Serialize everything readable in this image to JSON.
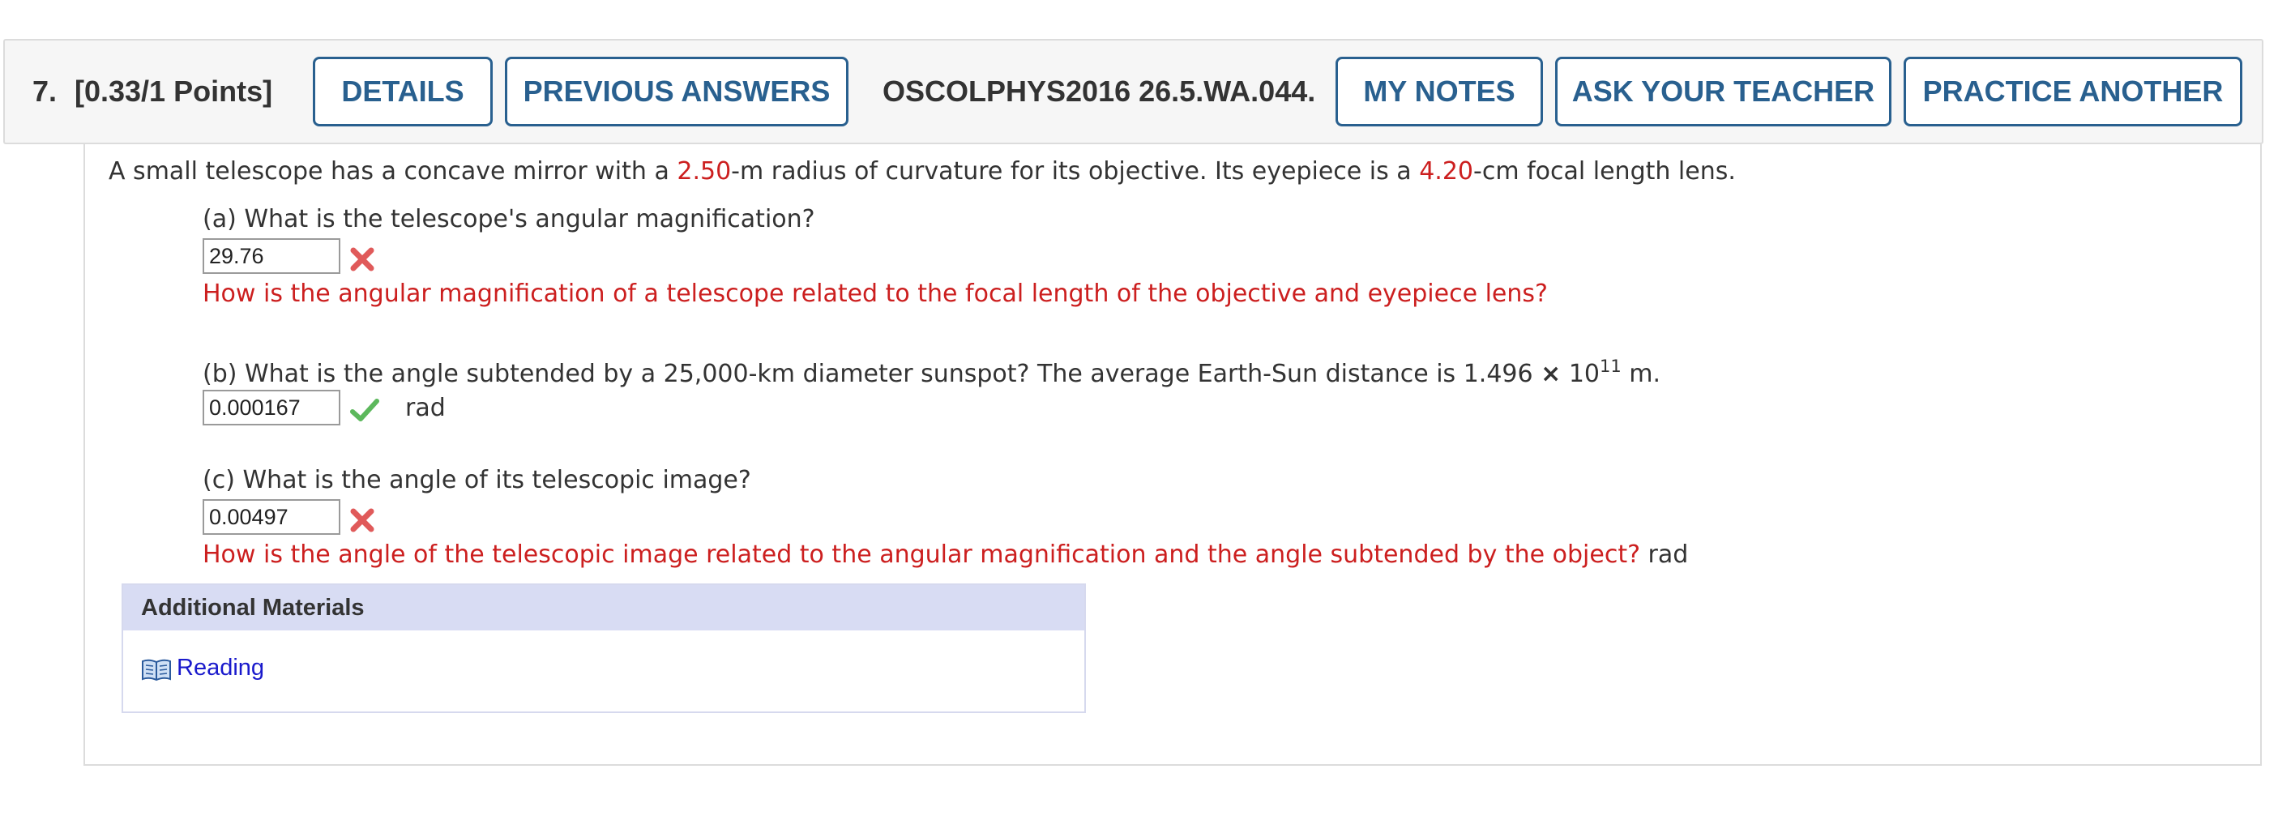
{
  "header": {
    "number": "7.",
    "points": "[0.33/1 Points]",
    "buttons": {
      "details": "DETAILS",
      "previous_answers": "PREVIOUS ANSWERS",
      "my_notes": "MY NOTES",
      "ask_teacher": "ASK YOUR TEACHER",
      "practice_another": "PRACTICE ANOTHER"
    },
    "problem_code": "OSCOLPHYS2016 26.5.WA.044."
  },
  "question": {
    "intro": {
      "p1": "A small telescope has a concave mirror with a ",
      "v1": "2.50",
      "p2": "-m radius of curvature for its objective. Its eyepiece is a ",
      "v2": "4.20",
      "p3": "-cm focal length lens."
    },
    "parts": {
      "a": {
        "prompt": "(a) What is the telescope's angular magnification?",
        "answer": "29.76",
        "status": "incorrect",
        "hint": "How is the angular magnification of a telescope related to the focal length of the objective and eyepiece lens?"
      },
      "b": {
        "prompt": "(b) What is the angle subtended by a 25,000-km diameter sunspot? The average Earth-Sun distance is 1.496 ",
        "times": "×",
        "base": "10",
        "exponent": "11",
        "prompt_end": " m.",
        "answer": "0.000167",
        "status": "correct",
        "unit": "rad"
      },
      "c": {
        "prompt": "(c) What is the angle of its telescopic image?",
        "answer": "0.00497",
        "status": "incorrect",
        "hint": "How is the angle of the telescopic image related to the angular magnification and the angle subtended by the object?",
        "unit": "rad"
      }
    }
  },
  "additional_materials": {
    "title": "Additional Materials",
    "link": "Reading",
    "link_icon": "book-icon"
  },
  "colors": {
    "button_blue": "#29608f",
    "red": "#cc1f1f",
    "green_check": "#5cb85c",
    "x_mark": "#e05a5a",
    "link_blue": "#1a1acc"
  }
}
